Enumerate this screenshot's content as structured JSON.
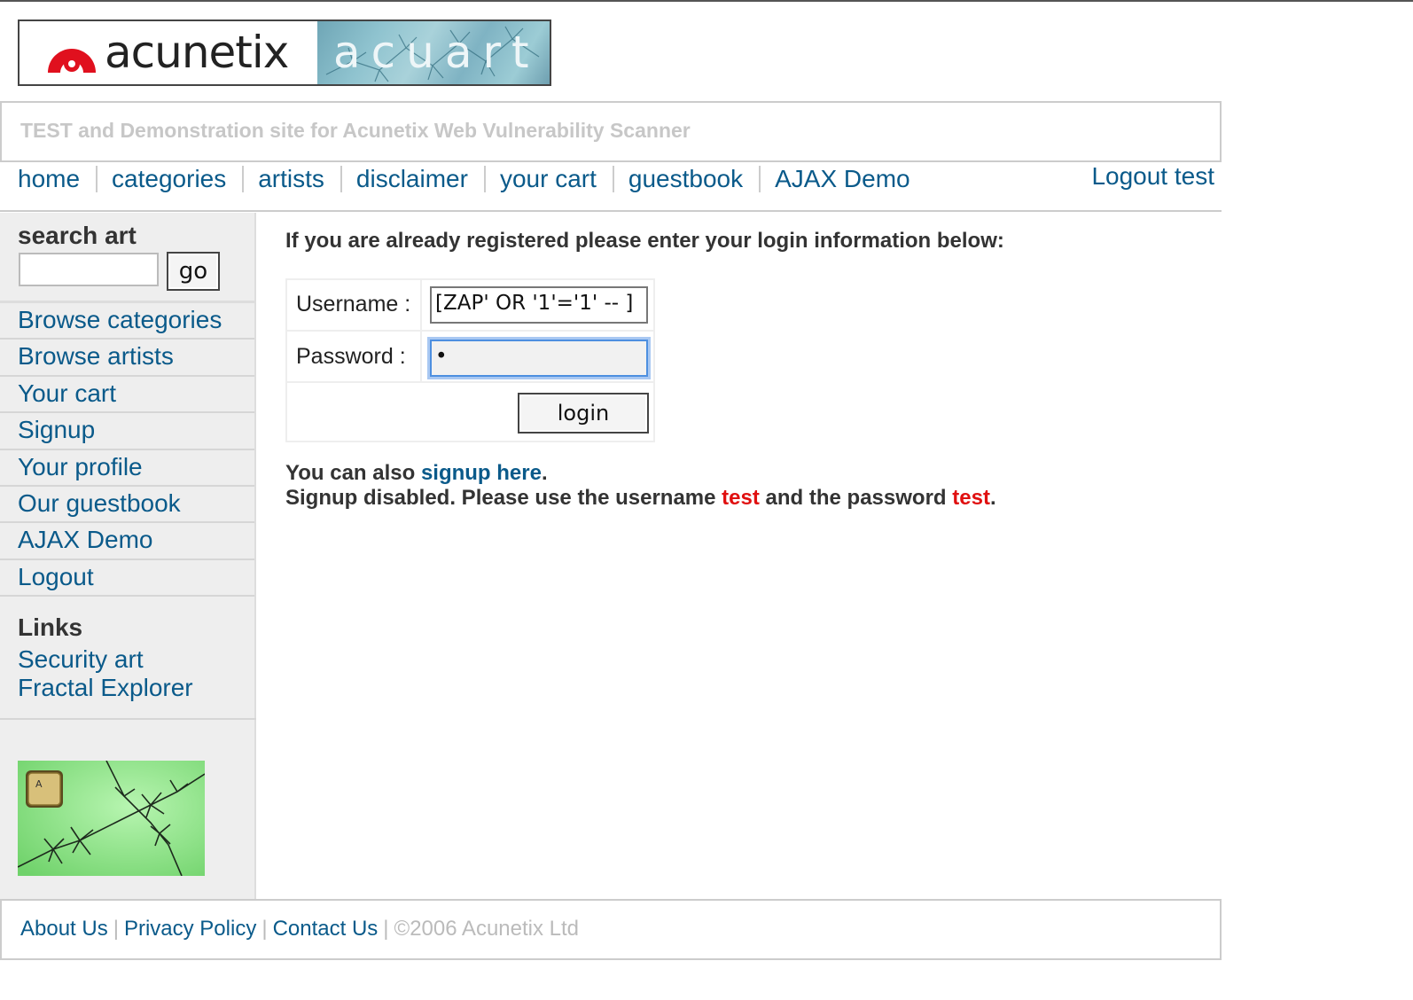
{
  "logo": {
    "brand": "acunetix",
    "product": "acuart"
  },
  "tagline": "TEST and Demonstration site for Acunetix Web Vulnerability Scanner",
  "topnav": {
    "items": [
      "home",
      "categories",
      "artists",
      "disclaimer",
      "your cart",
      "guestbook",
      "AJAX Demo"
    ],
    "logout": "Logout test"
  },
  "sidebar": {
    "search_title": "search art",
    "search_value": "",
    "go_label": "go",
    "items": [
      "Browse categories",
      "Browse artists",
      "Your cart",
      "Signup",
      "Your profile",
      "Our guestbook",
      "AJAX Demo",
      "Logout"
    ],
    "links_title": "Links",
    "links": [
      "Security art",
      "Fractal Explorer"
    ]
  },
  "main": {
    "intro": "If you are already registered please enter your login information below:",
    "username_label": "Username :",
    "username_value": "[ZAP' OR '1'='1' -- ]",
    "password_label": "Password :",
    "password_value": "•",
    "login_label": "login",
    "signup_prefix": "You can also",
    "signup_link": "signup here",
    "signup_suffix": ".",
    "disabled_prefix": "Signup disabled. Please use the username",
    "disabled_user": "test",
    "disabled_middle": "and the password",
    "disabled_pass": "test",
    "disabled_suffix": "."
  },
  "footer": {
    "links": [
      "About Us",
      "Privacy Policy",
      "Contact Us"
    ],
    "copyright": "©2006 Acunetix Ltd"
  },
  "colors": {
    "link": "#0a5a8a",
    "highlight": "#e01010",
    "sidebar_bg": "#eeeeee",
    "muted": "#c7c7c7"
  }
}
